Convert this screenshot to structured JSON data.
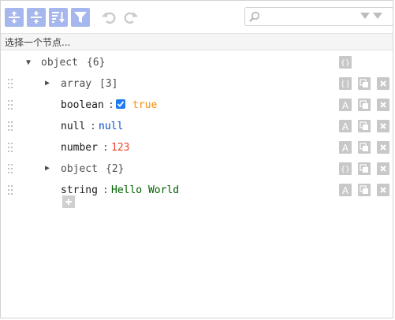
{
  "toolbar": {
    "buttons": [
      {
        "name": "expand-all"
      },
      {
        "name": "collapse-all"
      },
      {
        "name": "sort"
      },
      {
        "name": "filter"
      }
    ]
  },
  "search": {
    "value": "",
    "placeholder": ""
  },
  "navbar": {
    "label": "选择一个节点..."
  },
  "tree": {
    "root": {
      "field": "object",
      "count": "{6}"
    },
    "nodes": [
      {
        "field": "array",
        "count": "[3]",
        "type": "array"
      },
      {
        "field": "boolean",
        "value": "true",
        "type": "boolean",
        "checked": true
      },
      {
        "field": "null",
        "value": "null",
        "type": "null"
      },
      {
        "field": "number",
        "value": "123",
        "type": "number"
      },
      {
        "field": "object",
        "count": "{2}",
        "type": "object"
      },
      {
        "field": "string",
        "value": "Hello World",
        "type": "string"
      }
    ],
    "separator": ":"
  },
  "colors": {
    "toolbar_button": "#a6b7ee",
    "value_true": "#ff8c00",
    "value_null": "#004ed0",
    "value_number": "#ee422e",
    "value_string": "#006000"
  }
}
